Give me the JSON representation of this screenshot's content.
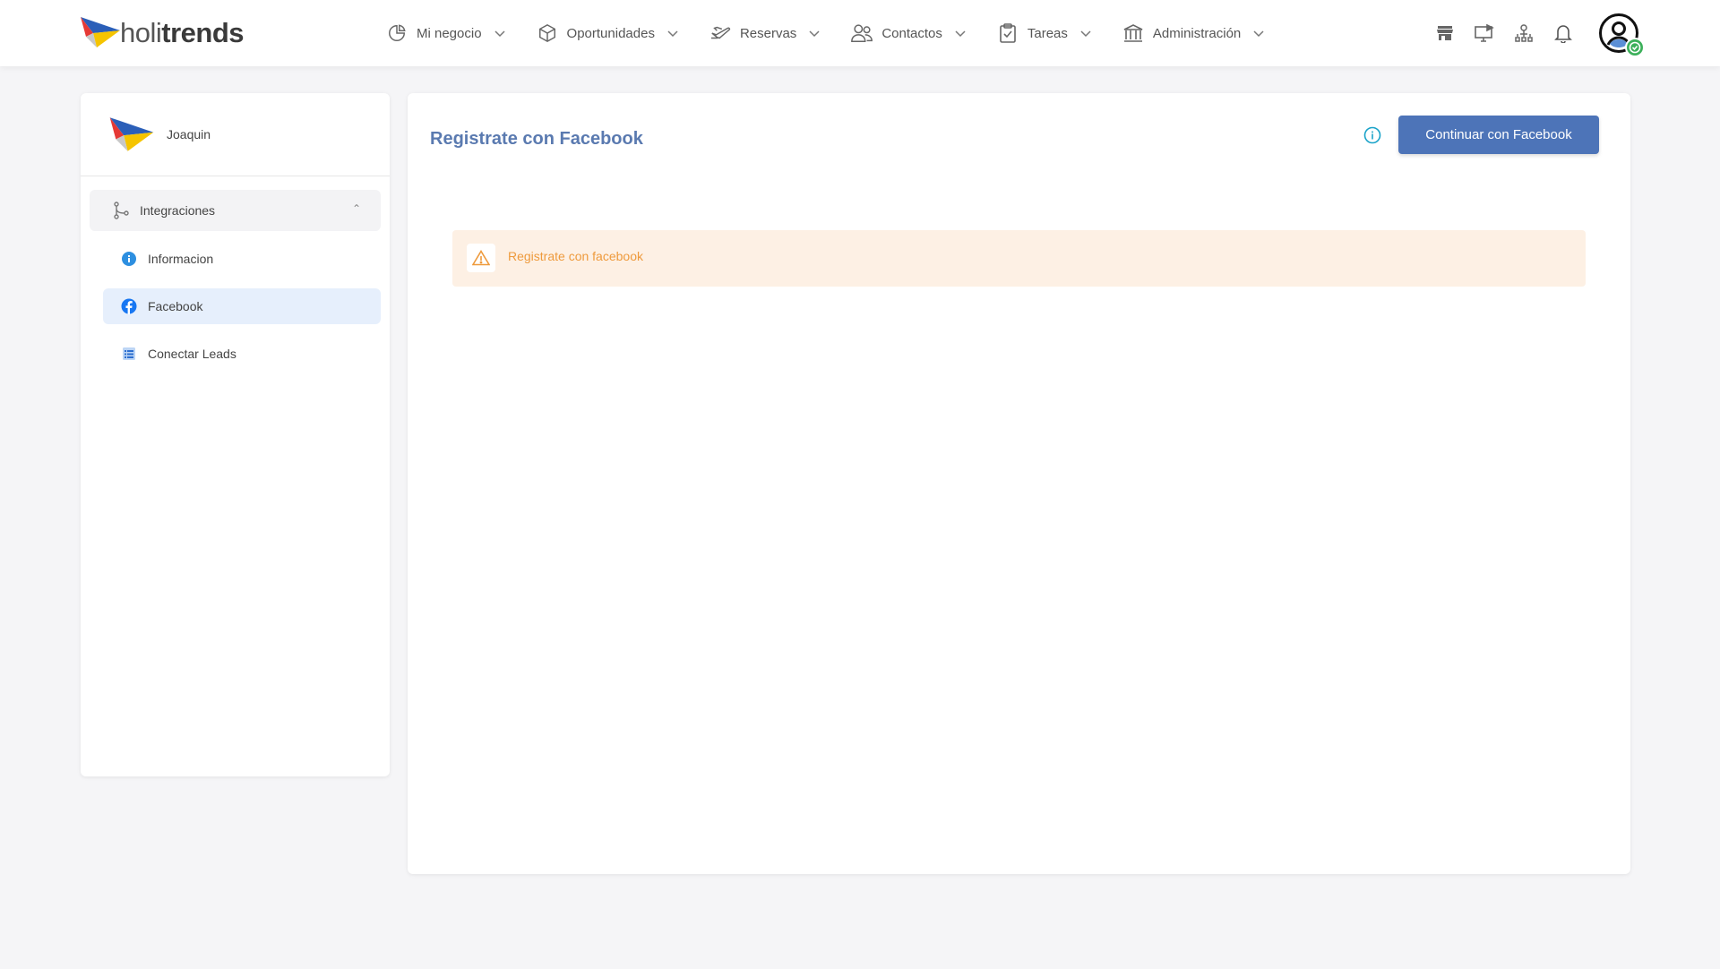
{
  "brand": {
    "name_light": "holi",
    "name_bold": "trends"
  },
  "nav": {
    "items": [
      {
        "label": "Mi negocio",
        "icon": "pie-chart-icon"
      },
      {
        "label": "Oportunidades",
        "icon": "cube-icon"
      },
      {
        "label": "Reservas",
        "icon": "plane-icon"
      },
      {
        "label": "Contactos",
        "icon": "users-icon"
      },
      {
        "label": "Tareas",
        "icon": "clipboard-check-icon"
      },
      {
        "label": "Administración",
        "icon": "bank-icon"
      }
    ]
  },
  "tools": [
    "store-icon",
    "screen-play-icon",
    "org-chart-icon",
    "bell-icon",
    "user-avatar-icon"
  ],
  "sidebar": {
    "org_name": "Joaquin",
    "group_label": "Integraciones",
    "items": [
      {
        "label": "Informacion",
        "icon": "info-icon"
      },
      {
        "label": "Facebook",
        "icon": "facebook-icon",
        "active": true
      },
      {
        "label": "Conectar Leads",
        "icon": "list-icon"
      }
    ]
  },
  "main": {
    "title": "Registrate con Facebook",
    "button_label": "Continuar con Facebook",
    "alert_text": "Registrate con facebook"
  },
  "colors": {
    "accent": "#4d74b8",
    "title": "#5a7ab0",
    "warning_bg": "#fdf0e4",
    "warning_text": "#ee9a3c",
    "active_bg": "#e6effc",
    "status_ok": "#3cb05a"
  }
}
